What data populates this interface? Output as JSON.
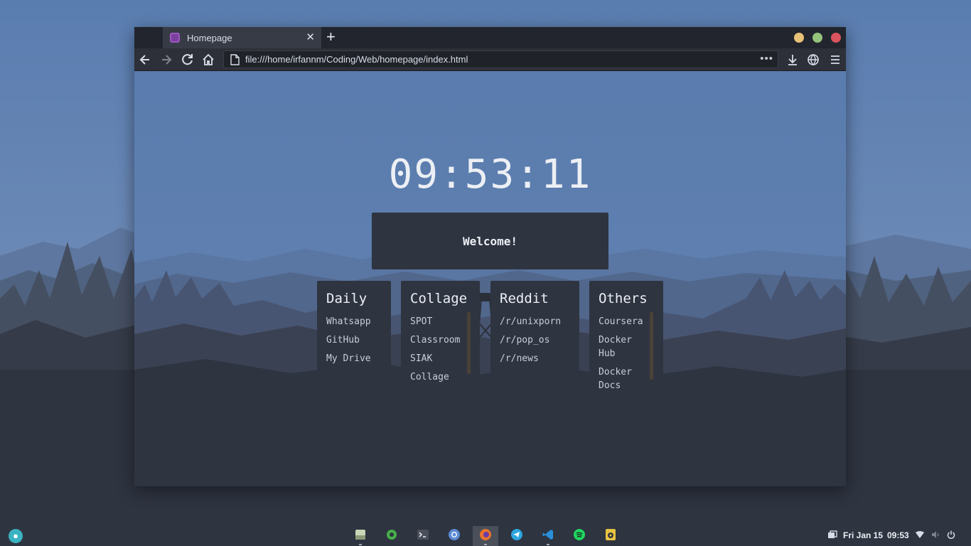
{
  "browser": {
    "tab_title": "Homepage",
    "tab_close": "✕",
    "new_tab": "+",
    "url": "file:///home/irfannm/Coding/Web/homepage/index.html",
    "url_more": "•••"
  },
  "page": {
    "clock": "09:53:11",
    "welcome": "Welcome!",
    "cards": [
      {
        "title": "Daily",
        "links": [
          "Whatsapp",
          "GitHub",
          "My Drive"
        ]
      },
      {
        "title": "Collage",
        "links": [
          "SPOT",
          "Classroom",
          "SIAK",
          "Collage"
        ]
      },
      {
        "title": "Reddit",
        "links": [
          "/r/unixporn",
          "/r/pop_os",
          "/r/news"
        ]
      },
      {
        "title": "Others",
        "links": [
          "Coursera",
          "Docker Hub",
          "Docker Docs"
        ]
      }
    ]
  },
  "taskbar": {
    "date": "Fri Jan 15",
    "time": "09:53",
    "dock": [
      {
        "name": "files-icon",
        "color": "#c9d6b7"
      },
      {
        "name": "settings-icon",
        "color": "#48b04a"
      },
      {
        "name": "terminal-icon",
        "color": "#5a5f6a"
      },
      {
        "name": "chromium-icon",
        "color": "#5b8ad4"
      },
      {
        "name": "firefox-icon",
        "color": "#e8742b"
      },
      {
        "name": "telegram-icon",
        "color": "#2ca5e0"
      },
      {
        "name": "vscode-icon",
        "color": "#2a8fd9"
      },
      {
        "name": "spotify-icon",
        "color": "#1ed760"
      },
      {
        "name": "speaker-icon",
        "color": "#e8c340"
      }
    ]
  },
  "colors": {
    "card_bg": "#2e3440",
    "text": "#eceff4",
    "wallpaper_sky": "#5c7fae"
  }
}
